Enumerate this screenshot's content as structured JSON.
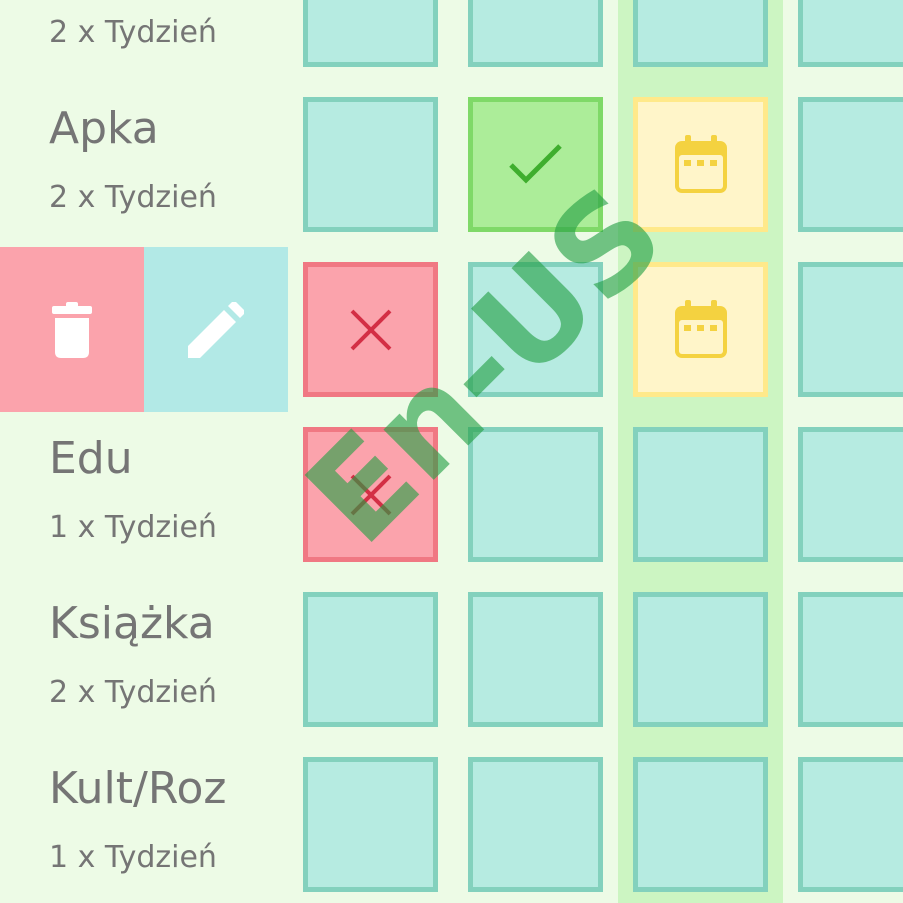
{
  "habits": [
    {
      "title": "",
      "frequency": "2 x Tydzień",
      "cells": [
        "empty",
        "empty",
        "empty",
        "empty"
      ]
    },
    {
      "title": "Apka",
      "frequency": "2 x Tydzień",
      "cells": [
        "empty",
        "done",
        "planned",
        "empty"
      ]
    },
    {
      "title": "",
      "frequency": "",
      "cells": [
        "fail",
        "empty",
        "planned",
        "empty"
      ],
      "swiped": true
    },
    {
      "title": "Edu",
      "frequency": "1 x Tydzień",
      "cells": [
        "fail",
        "empty",
        "empty",
        "empty"
      ]
    },
    {
      "title": "Książka",
      "frequency": "2 x Tydzień",
      "cells": [
        "empty",
        "empty",
        "empty",
        "empty"
      ]
    },
    {
      "title": "Kult/Roz",
      "frequency": "1 x Tydzień",
      "cells": [
        "empty",
        "empty",
        "empty",
        "empty"
      ]
    }
  ],
  "swipe_actions": {
    "delete_icon": "trash-icon",
    "edit_icon": "pencil-icon"
  },
  "cell_icons": {
    "done": "check-icon",
    "fail": "x-icon",
    "planned": "calendar-icon"
  },
  "colors": {
    "background": "#edfbe6",
    "today_column": "#ccf5c2",
    "cell_empty": "#b6ebe1",
    "cell_done": "#aced99",
    "cell_fail": "#fba3ac",
    "cell_planned": "#fff5c9",
    "delete_action": "#fba3ac",
    "edit_action": "#b2e9e6"
  },
  "watermark": "En-US"
}
